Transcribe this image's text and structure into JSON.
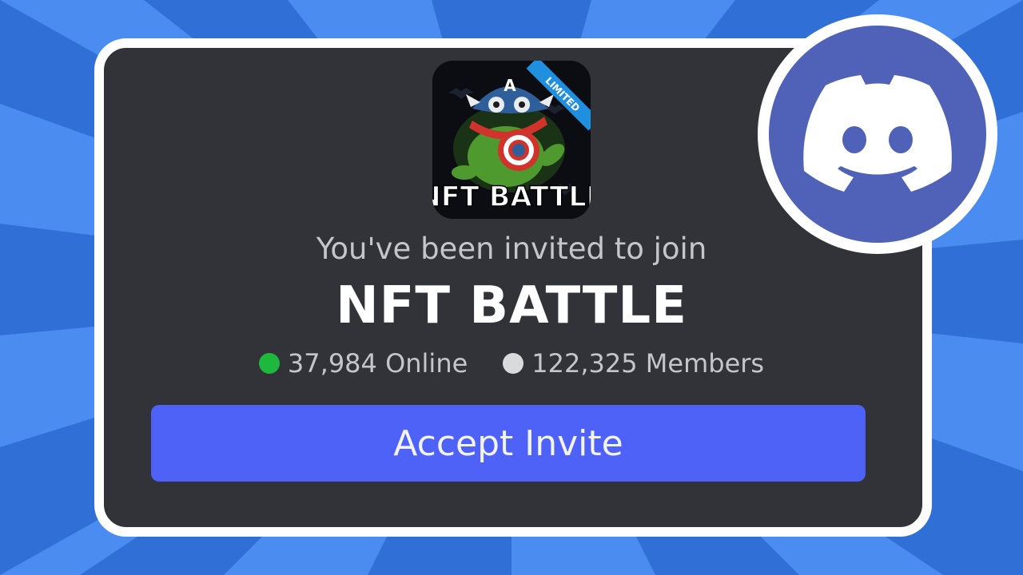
{
  "background": {
    "color_primary": "#2f6fd6",
    "color_secondary": "#4a8cf0"
  },
  "invite": {
    "subtitle": "You've been invited to join",
    "server_name": "NFT BATTLE",
    "online_count": "37,984 Online",
    "member_count": "122,325 Members",
    "accept_label": "Accept Invite"
  },
  "server_icon": {
    "ribbon_label": "LIMITED",
    "logo_text": "NFT BATTLE",
    "helmet_letter": "A"
  },
  "colors": {
    "card_bg": "#313338",
    "accent": "#4e62f7",
    "online": "#1fb83f",
    "discord_brand": "#4f62b8"
  },
  "brand_icon": "discord-logo-icon"
}
